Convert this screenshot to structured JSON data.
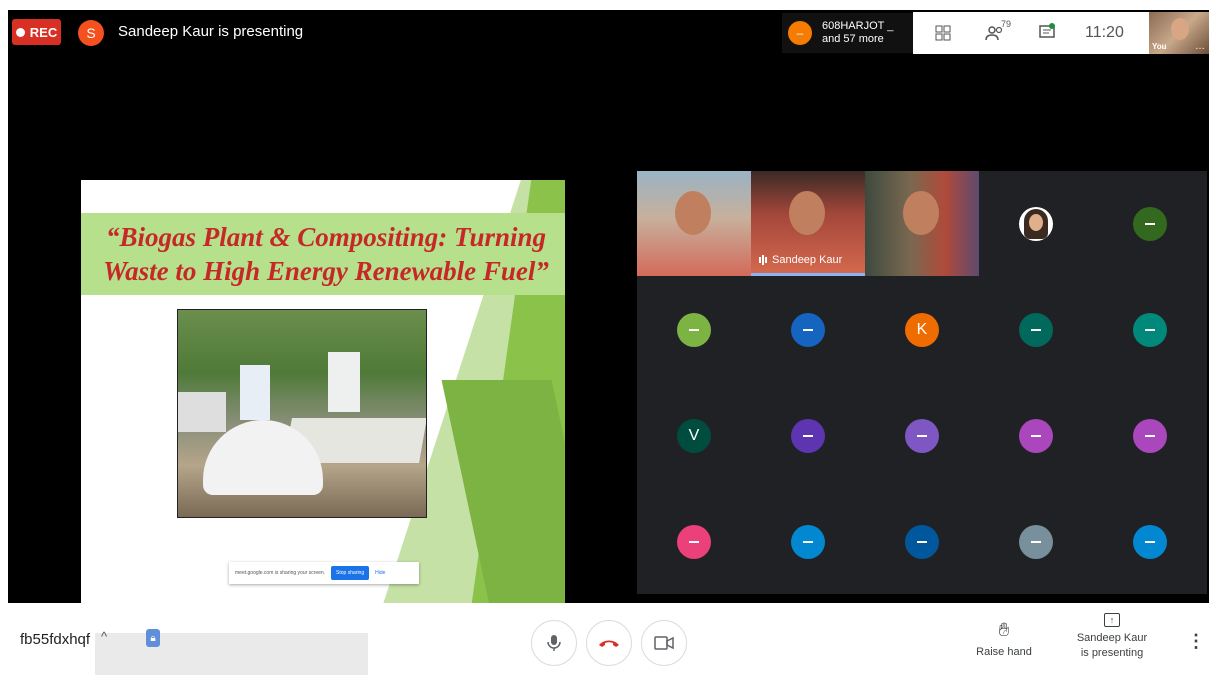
{
  "top_bar": {
    "rec_label": "REC",
    "presenter_initial": "S",
    "presenter_text": "Sandeep Kaur is presenting",
    "participants_chip": {
      "name": "608HARJOT _",
      "more": "and 57 more"
    },
    "people_count": "79",
    "time": "11:20",
    "self_label": "You"
  },
  "slide": {
    "title_line1": "“Biogas Plant & Compositing: Turning",
    "title_line2": "Waste to High Energy Renewable Fuel”",
    "share_text": "meet.google.com is sharing your screen.",
    "stop_label": "Stop sharing",
    "hide_label": "Hide"
  },
  "grid": {
    "speaker_name": "Sandeep Kaur",
    "tiles": [
      {
        "type": "video",
        "style": "vid1"
      },
      {
        "type": "video",
        "style": "vid2",
        "speaker": true
      },
      {
        "type": "video",
        "style": "vid3"
      },
      {
        "type": "photo"
      },
      {
        "type": "avatar",
        "color": "#33691e",
        "letter": ""
      },
      {
        "type": "avatar",
        "color": "#7cb342",
        "letter": ""
      },
      {
        "type": "avatar",
        "color": "#1565c0",
        "letter": ""
      },
      {
        "type": "avatar",
        "color": "#ef6c00",
        "letter": "K"
      },
      {
        "type": "avatar",
        "color": "#00695c",
        "letter": ""
      },
      {
        "type": "avatar",
        "color": "#00897b",
        "letter": ""
      },
      {
        "type": "avatar",
        "color": "#004d40",
        "letter": "V"
      },
      {
        "type": "avatar",
        "color": "#5e35b1",
        "letter": ""
      },
      {
        "type": "avatar",
        "color": "#7e57c2",
        "letter": ""
      },
      {
        "type": "avatar",
        "color": "#ab47bc",
        "letter": ""
      },
      {
        "type": "avatar",
        "color": "#ab47bc",
        "letter": ""
      },
      {
        "type": "avatar",
        "color": "#ec407a",
        "letter": ""
      },
      {
        "type": "avatar",
        "color": "#0288d1",
        "letter": ""
      },
      {
        "type": "avatar",
        "color": "#01579b",
        "letter": ""
      },
      {
        "type": "avatar",
        "color": "#78909c",
        "letter": ""
      },
      {
        "type": "avatar",
        "color": "#0288d1",
        "letter": ""
      }
    ]
  },
  "bottom_bar": {
    "meeting_code": "fb55fdxhqf",
    "raise_hand": "Raise hand",
    "presenting_line1": "Sandeep Kaur",
    "presenting_line2": "is presenting"
  },
  "icons": {
    "mic": "mic-icon",
    "hangup": "hangup-icon",
    "camera": "camera-icon",
    "hand": "hand-icon",
    "present": "present-icon",
    "more": "more-vert-icon"
  }
}
